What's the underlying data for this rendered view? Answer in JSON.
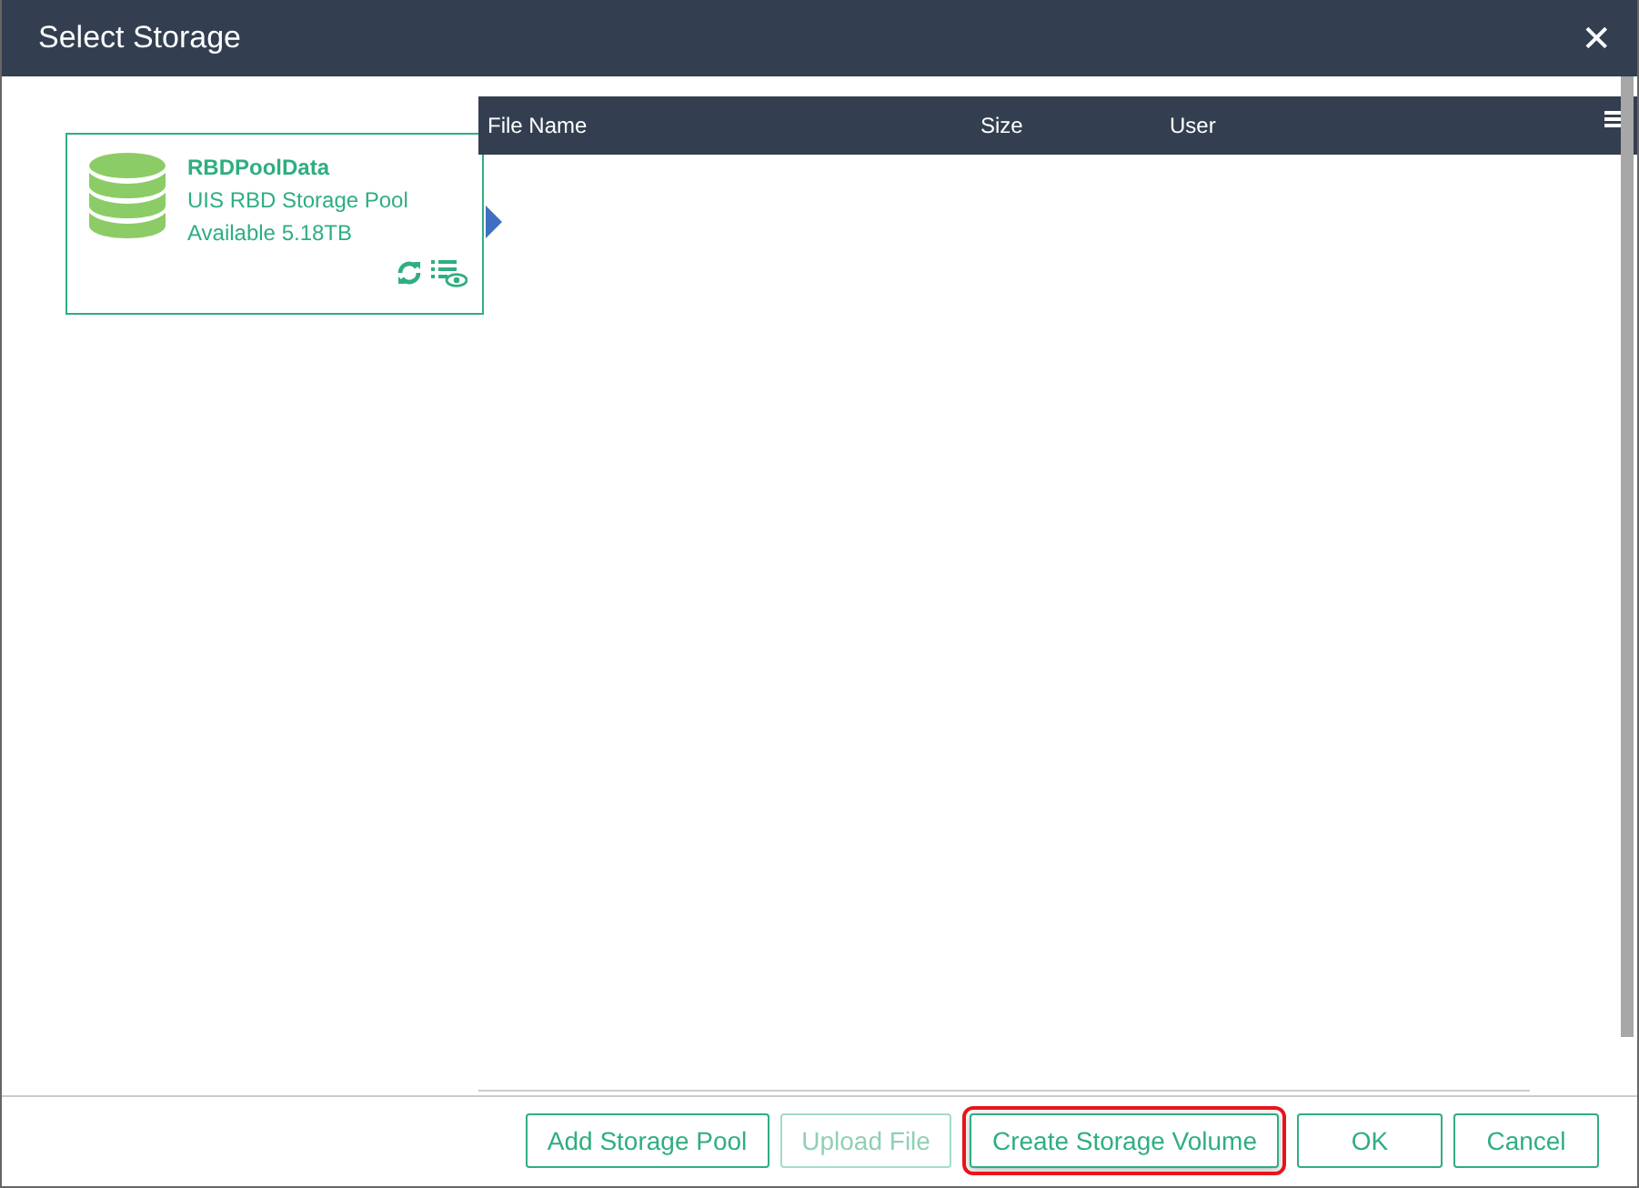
{
  "window": {
    "title": "Select Storage",
    "close": "✕"
  },
  "pools": [
    {
      "name": "RBDPoolData",
      "type": "UIS RBD Storage Pool",
      "available": "Available 5.18TB",
      "selected": true
    }
  ],
  "table": {
    "columns": [
      "File Name",
      "Size",
      "User"
    ]
  },
  "buttons": [
    {
      "label": "Add Storage Pool",
      "disabled": false,
      "highlighted": false
    },
    {
      "label": "Upload File",
      "disabled": true,
      "highlighted": false
    },
    {
      "label": "Create Storage Volume",
      "disabled": false,
      "highlighted": true
    },
    {
      "label": "OK",
      "disabled": false,
      "highlighted": false
    },
    {
      "label": "Cancel",
      "disabled": false,
      "highlighted": false
    }
  ]
}
